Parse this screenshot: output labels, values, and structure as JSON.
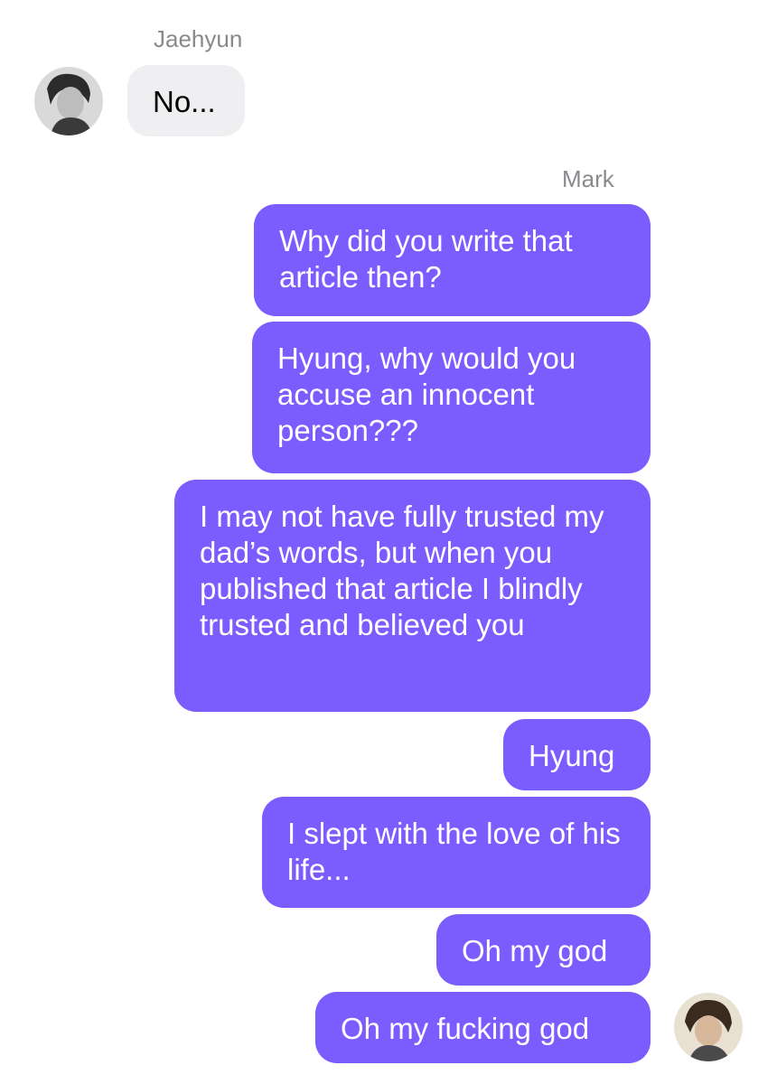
{
  "chat": {
    "incoming_sender": "Jaehyun",
    "outgoing_sender": "Mark",
    "messages": [
      {
        "from": "Jaehyun",
        "text": "No..."
      },
      {
        "from": "Mark",
        "text": "Why did you write that article then?"
      },
      {
        "from": "Mark",
        "text": "Hyung, why would you accuse an innocent person???"
      },
      {
        "from": "Mark",
        "text": "I may not have fully trusted my dad’s words, but when you published that article I blindly trusted and believed you"
      },
      {
        "from": "Mark",
        "text": "Hyung"
      },
      {
        "from": "Mark",
        "text": "I slept with the love of his life..."
      },
      {
        "from": "Mark",
        "text": "Oh my god"
      },
      {
        "from": "Mark",
        "text": "Oh my fucking god"
      }
    ]
  },
  "colors": {
    "incoming_bubble": "#efeff1",
    "outgoing_bubble": "#7b5cff",
    "outgoing_text": "#ffffff",
    "sender_name": "#8a8a8e"
  }
}
